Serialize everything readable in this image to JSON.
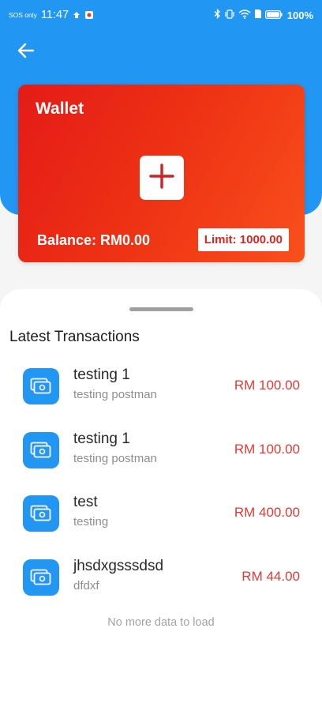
{
  "status_bar": {
    "sos": "SOS only",
    "time": "11:47",
    "battery": "100%"
  },
  "colors": {
    "header_blue": "#2196f3",
    "card_gradient_start": "#e41b17",
    "card_gradient_end": "#f9501c",
    "amount_red": "#e53935"
  },
  "wallet": {
    "title": "Wallet",
    "balance": "Balance: RM0.00",
    "limit": "Limit: 1000.00"
  },
  "transactions": {
    "heading": "Latest Transactions",
    "items": [
      {
        "title": "testing 1",
        "subtitle": "testing postman",
        "amount": "RM 100.00"
      },
      {
        "title": "testing 1",
        "subtitle": "testing postman",
        "amount": "RM 100.00"
      },
      {
        "title": "test",
        "subtitle": "testing",
        "amount": "RM 400.00"
      },
      {
        "title": "jhsdxgsssdsd",
        "subtitle": "dfdxf",
        "amount": "RM 44.00"
      }
    ],
    "footer": "No more data to load"
  },
  "icons": {
    "back": "arrow-left-icon",
    "add": "plus-icon",
    "transaction": "money-icon"
  }
}
